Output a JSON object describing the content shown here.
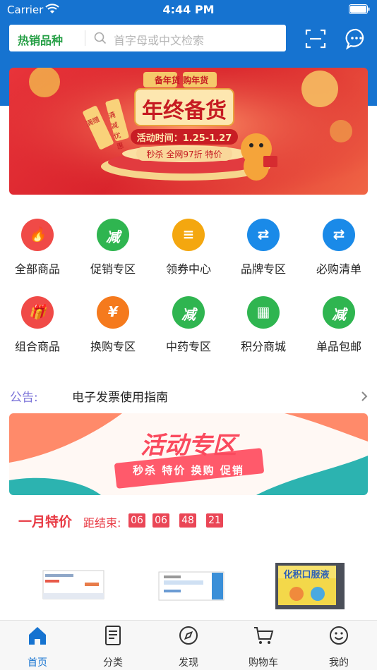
{
  "status": {
    "carrier": "Carrier",
    "time": "4:44 PM"
  },
  "search": {
    "hot_label": "热销品种",
    "placeholder": "首字母或中文检索"
  },
  "banner": {
    "top_tags": "备年货  购年货",
    "title": "年终备货",
    "date": "活动时间：1.25-1.27",
    "offer": "秒杀   全网97折   特价",
    "side_left": "满赠",
    "side_right": "满减优惠"
  },
  "grid": {
    "items": [
      {
        "label": "全部商品",
        "icon": "fire-icon",
        "color": "#f04a47",
        "glyph": "🔥"
      },
      {
        "label": "促销专区",
        "icon": "discount-icon",
        "color": "#2fb550",
        "glyph": "减"
      },
      {
        "label": "领券中心",
        "icon": "coin-icon",
        "color": "#f4a70f",
        "glyph": "≡"
      },
      {
        "label": "品牌专区",
        "icon": "exchange-icon",
        "color": "#1a8ae8",
        "glyph": "⇄"
      },
      {
        "label": "必购清单",
        "icon": "exchange-icon",
        "color": "#1a8ae8",
        "glyph": "⇄"
      },
      {
        "label": "组合商品",
        "icon": "gift-icon",
        "color": "#f04a47",
        "glyph": "🎁"
      },
      {
        "label": "换购专区",
        "icon": "ticket-icon",
        "color": "#f57a1d",
        "glyph": "¥"
      },
      {
        "label": "中药专区",
        "icon": "discount-icon",
        "color": "#2fb550",
        "glyph": "减"
      },
      {
        "label": "积分商城",
        "icon": "grid-icon",
        "color": "#2fb550",
        "glyph": "▦"
      },
      {
        "label": "单品包邮",
        "icon": "discount-icon",
        "color": "#2fb550",
        "glyph": "减"
      }
    ],
    "page_indicator": {
      "pages": 2,
      "active": 1
    }
  },
  "notice": {
    "title": "公告:",
    "text": "电子发票使用指南"
  },
  "activity": {
    "title": "活动专区",
    "subtitle": "秒杀 特价 换购 促销"
  },
  "special": {
    "title": "一月特价",
    "countdown_label": "距结束:",
    "countdown": [
      "06",
      "06",
      "48",
      "21"
    ]
  },
  "products": [
    {
      "name": "product-box-1"
    },
    {
      "name": "product-box-2"
    },
    {
      "name": "product-box-3",
      "text": "化积口服液"
    }
  ],
  "tabs": [
    {
      "label": "首页",
      "icon": "home-icon",
      "active": true
    },
    {
      "label": "分类",
      "icon": "list-icon",
      "active": false
    },
    {
      "label": "发现",
      "icon": "compass-icon",
      "active": false
    },
    {
      "label": "购物车",
      "icon": "cart-icon",
      "active": false
    },
    {
      "label": "我的",
      "icon": "smile-icon",
      "active": false
    }
  ],
  "colors": {
    "brand_blue": "#1673d0",
    "hot_green": "#27a047",
    "special_red": "#e83a44",
    "notice_purple": "#7a72d8"
  }
}
